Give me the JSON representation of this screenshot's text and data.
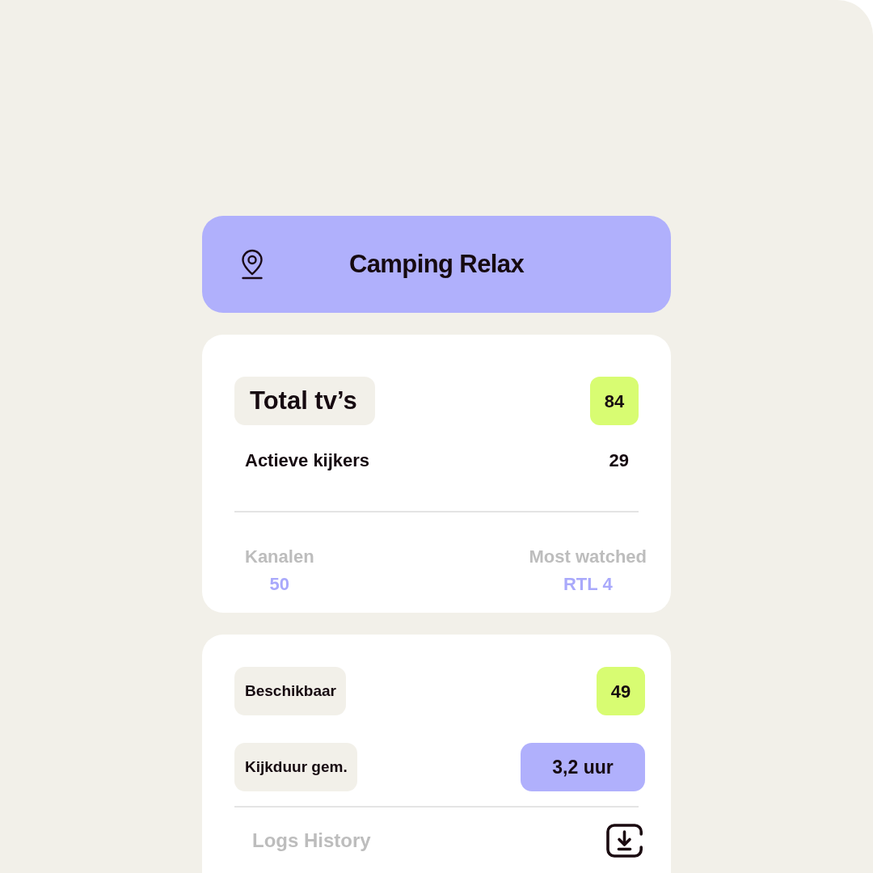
{
  "header": {
    "title": "Camping Relax"
  },
  "overview": {
    "total": {
      "label": "Total tv’s",
      "value": "84"
    },
    "active": {
      "label": "Actieve kijkers",
      "value": "29"
    },
    "stats": [
      {
        "label": "Kanalen",
        "value": "50"
      },
      {
        "label": "Most watched",
        "value": "RTL 4"
      }
    ]
  },
  "availability": {
    "rows": [
      {
        "label": "Beschikbaar",
        "value": "49",
        "kind": "count"
      },
      {
        "label": "Kijkduur gem.",
        "value": "3,2 uur",
        "kind": "duration"
      }
    ],
    "logs": {
      "label": "Logs History"
    }
  }
}
